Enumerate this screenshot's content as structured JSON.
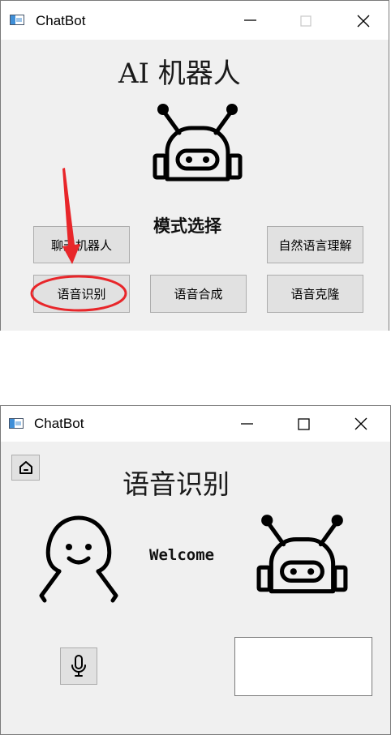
{
  "window1": {
    "title": "ChatBot",
    "heading": "AI 机器人",
    "mode_label": "模式选择",
    "buttons": {
      "chat_robot": "聊天机器人",
      "nlu": "自然语言理解",
      "speech_recognition": "语音识别",
      "speech_synthesis": "语音合成",
      "voice_clone": "语音克隆"
    }
  },
  "window2": {
    "title": "ChatBot",
    "heading": "语音识别",
    "welcome": "Welcome",
    "output_text": ""
  },
  "icons": {
    "app": "chatbot-app-icon",
    "robot": "robot-icon",
    "user": "user-icon",
    "home": "home-icon",
    "mic": "microphone-icon",
    "annotation_arrow": "red-arrow",
    "annotation_circle": "red-ellipse"
  },
  "colors": {
    "annotation": "#e8262a",
    "window_bg": "#f0f0f0",
    "button_bg": "#e1e1e1"
  }
}
